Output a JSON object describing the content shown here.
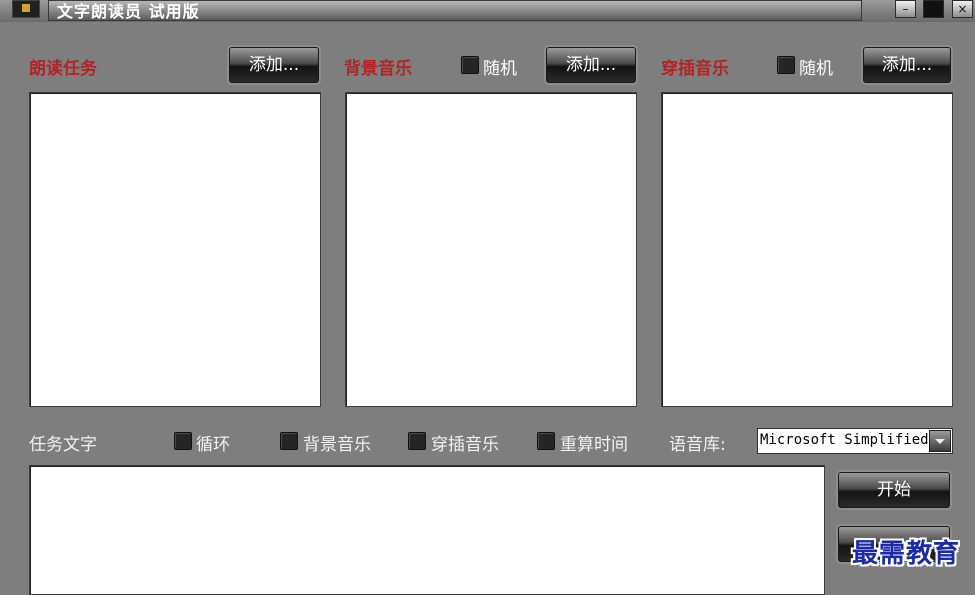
{
  "window": {
    "title": "文字朗读员 试用版",
    "controls": {
      "minimize": "–",
      "close": "×"
    }
  },
  "columns": [
    {
      "label": "朗读任务",
      "add_button": "添加..."
    },
    {
      "label": "背景音乐",
      "random_label": "随机",
      "add_button": "添加..."
    },
    {
      "label": "穿插音乐",
      "random_label": "随机",
      "add_button": "添加..."
    }
  ],
  "bottom": {
    "task_text_label": "任务文字",
    "options": [
      "循环",
      "背景音乐",
      "穿插音乐",
      "重算时间"
    ],
    "voice_label": "语音库:",
    "voice_value": "Microsoft Simplified Chinese",
    "start_button": "开始"
  },
  "watermark": "最需教育",
  "colors": {
    "background": "#7e7e7e",
    "section_label": "#b32424",
    "watermark": "#1b2aa8"
  }
}
